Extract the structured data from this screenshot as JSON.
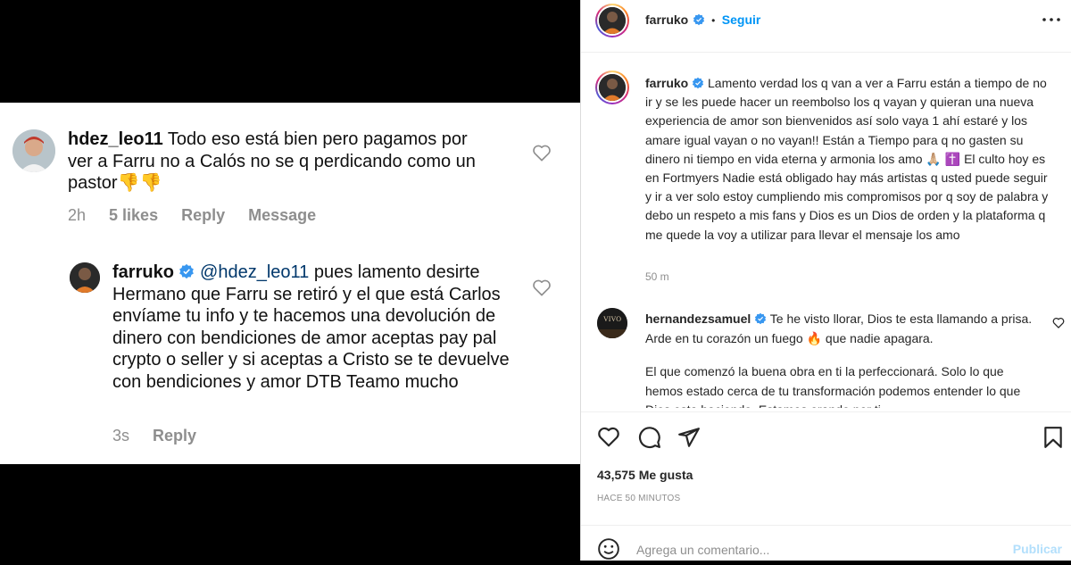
{
  "left": {
    "comment1": {
      "username": "hdez_leo11",
      "text": "Todo eso está bien pero pagamos por ver a Farru no a Calós no se q perdicando como un pastor",
      "emoji": "👎👎",
      "time": "2h",
      "likes": "5 likes",
      "reply": "Reply",
      "message": "Message"
    },
    "comment2": {
      "username": "farruko",
      "mention": "@hdez_leo11",
      "text": "pues lamento desirte Hermano que Farru se retiró y el que está Carlos envíame tu info y te hacemos una devolución de dinero con bendiciones de amor aceptas pay pal crypto o seller y si aceptas a Cristo se te devuelve con bendiciones y amor DTB Teamo mucho",
      "time": "3s",
      "reply": "Reply"
    }
  },
  "right": {
    "header": {
      "username": "farruko",
      "separator": "•",
      "follow": "Seguir",
      "more_icon": "more-horizontal-icon"
    },
    "caption": {
      "username": "farruko",
      "part1": "Lamento verdad los q van a ver a Farru están a tiempo de no ir y se les puede hacer un reembolso los q vayan y quieran una nueva experiencia de amor son bienvenidos así solo vaya 1 ahí estaré y los amare igual vayan o no vayan!! Están a Tiempo para q no gasten su dinero ni tiempo en vida eterna y armonia los amo",
      "emoji1": "🙏🏼",
      "emoji2": "✝️",
      "part2": "El culto hoy es en Fortmyers Nadie está obligado hay más artistas q usted puede seguir y ir a ver solo estoy cumpliendo mis compromisos por q soy de palabra y debo un respeto a mis fans y Dios es un Dios de orden y la plataforma q me quede la voy a utilizar para llevar el mensaje los amo",
      "time": "50 m"
    },
    "comment": {
      "username": "hernandezsamuel",
      "avatar_text": "VIVO",
      "part1": "Te he visto llorar, Dios te esta llamando a prisa. Arde en tu corazón un fuego",
      "emoji": "🔥",
      "part2": "que nadie apagara.",
      "para2": "El que comenzó la buena obra en ti la perfeccionará. Solo lo que hemos estado cerca de tu transformación podemos entender lo que Dios esta haciendo. Estamos orando por ti"
    },
    "actions": {
      "like_icon": "heart-icon",
      "comment_icon": "comment-icon",
      "share_icon": "send-icon",
      "save_icon": "bookmark-icon"
    },
    "likes": "43,575 Me gusta",
    "time_ago": "HACE 50 MINUTOS",
    "add_comment": {
      "emoji_icon": "smiley-icon",
      "placeholder": "Agrega un comentario...",
      "publish": "Publicar"
    }
  },
  "colors": {
    "link": "#00376b",
    "follow": "#0095f6",
    "verified": "#3897f0",
    "publish_disabled": "#b2dffc"
  }
}
